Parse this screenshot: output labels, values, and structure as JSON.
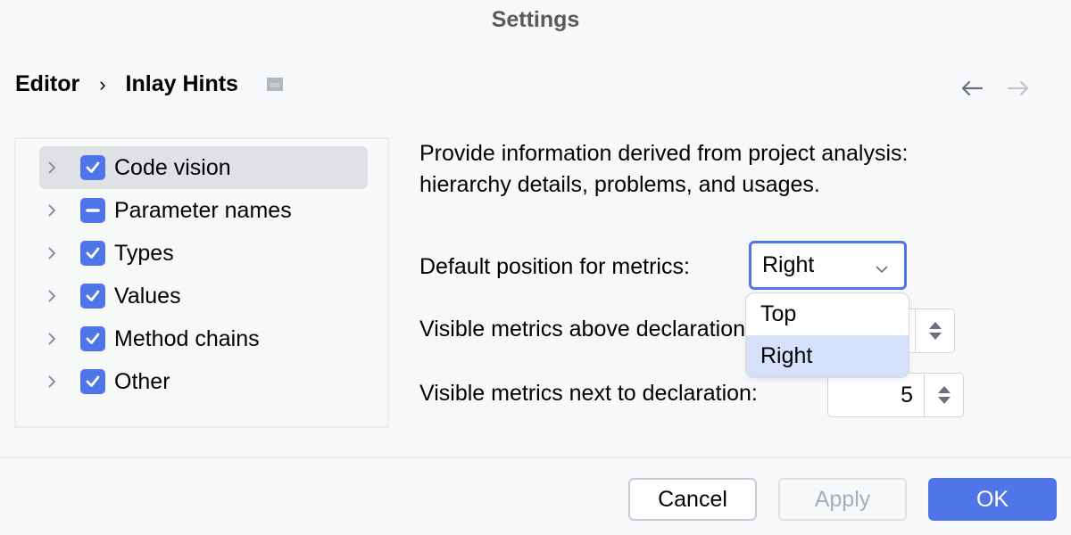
{
  "window": {
    "title": "Settings"
  },
  "breadcrumb": {
    "items": [
      "Editor",
      "Inlay Hints"
    ],
    "separator": "›",
    "window_icon": "window-icon"
  },
  "navigation": {
    "back_icon": "arrow-left-icon",
    "forward_icon": "arrow-right-icon",
    "forward_enabled": false
  },
  "tree": {
    "items": [
      {
        "label": "Code vision",
        "state": "checked",
        "selected": true
      },
      {
        "label": "Parameter names",
        "state": "indeterminate",
        "selected": false
      },
      {
        "label": "Types",
        "state": "checked",
        "selected": false
      },
      {
        "label": "Values",
        "state": "checked",
        "selected": false
      },
      {
        "label": "Method chains",
        "state": "checked",
        "selected": false
      },
      {
        "label": "Other",
        "state": "checked",
        "selected": false
      }
    ]
  },
  "panel": {
    "description_line1": "Provide information derived from project analysis:",
    "description_line2": "hierarchy details, problems, and usages.",
    "position_label": "Default position for metrics:",
    "position_value": "Right",
    "position_options": [
      "Top",
      "Right"
    ],
    "position_highlighted": "Right",
    "above_label": "Visible metrics above declaration:",
    "above_value": "",
    "next_label": "Visible metrics next to declaration:",
    "next_value": "5"
  },
  "footer": {
    "cancel": "Cancel",
    "apply": "Apply",
    "ok": "OK"
  },
  "colors": {
    "accent": "#4f75e8",
    "selection": "#dfe1e5",
    "popup_highlight": "#d5e0fb",
    "disabled_text": "#a8adbd"
  }
}
